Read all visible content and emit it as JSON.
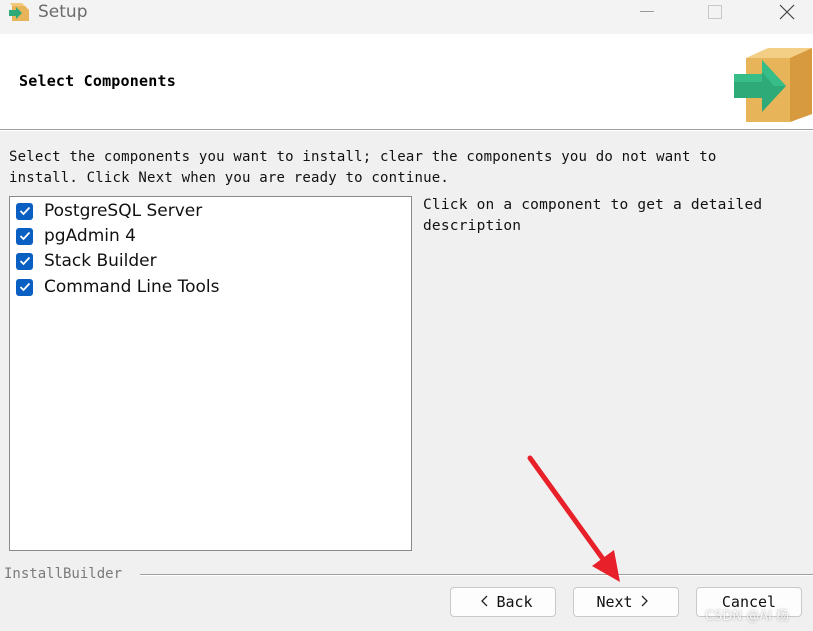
{
  "window": {
    "title": "Setup",
    "app_icon": "installer-box-icon"
  },
  "header": {
    "title": "Select Components",
    "logo_icon": "installer-box-arrow-icon"
  },
  "instructions": "Select the components you want to install; clear the components you do not want to\ninstall. Click Next when you are ready to continue.",
  "components": [
    {
      "label": "PostgreSQL Server",
      "checked": true
    },
    {
      "label": "pgAdmin 4",
      "checked": true
    },
    {
      "label": "Stack Builder",
      "checked": true
    },
    {
      "label": "Command Line Tools",
      "checked": true
    }
  ],
  "description": "Click on a component to get a detailed description",
  "footer": {
    "brand": "InstallBuilder",
    "back_label": "Back",
    "next_label": "Next",
    "cancel_label": "Cancel"
  },
  "watermark": "CSDN @AI 杨",
  "colors": {
    "checkbox": "#0a5fc2",
    "annotation_arrow": "#e8202a",
    "logo_green": "#2eaa78",
    "logo_box": "#e8b45a"
  }
}
